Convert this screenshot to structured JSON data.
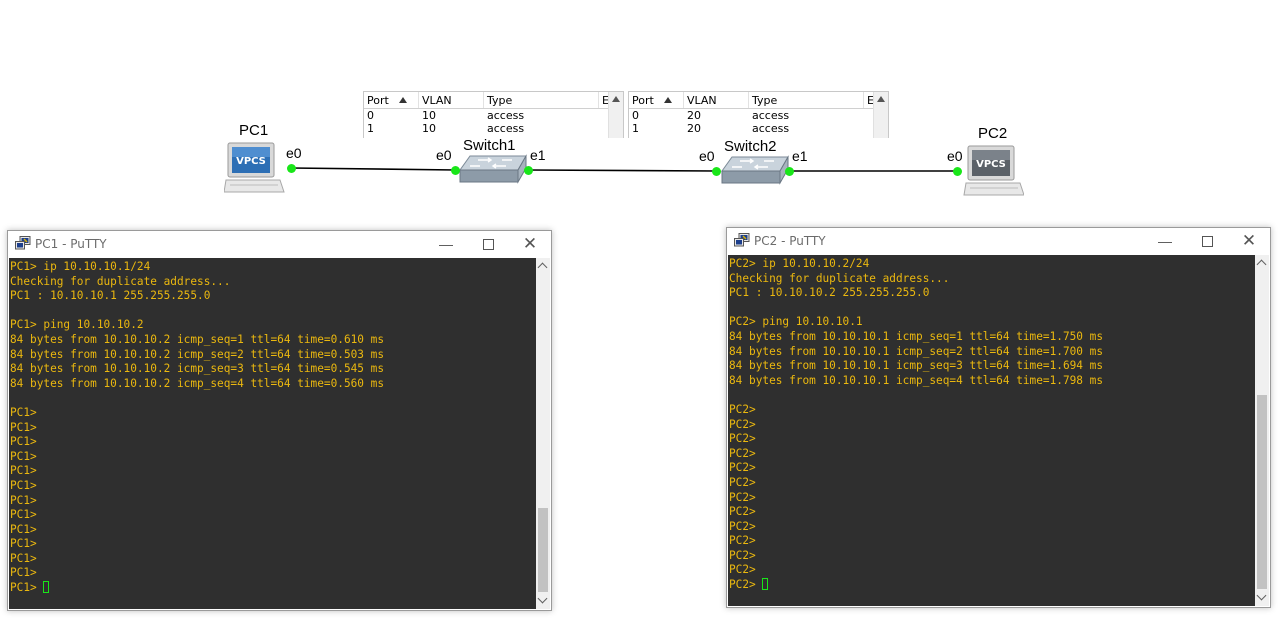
{
  "topology": {
    "nodes": {
      "pc1": {
        "label": "PC1",
        "icon_text": "VPCS"
      },
      "pc2": {
        "label": "PC2",
        "icon_text": "VPCS"
      },
      "switch1": {
        "label": "Switch1"
      },
      "switch2": {
        "label": "Switch2"
      }
    },
    "ports": {
      "pc1_e0": "e0",
      "sw1_e0": "e0",
      "sw1_e1": "e1",
      "sw2_e0": "e0",
      "sw2_e1": "e1",
      "pc2_e0": "e0"
    },
    "link_color": "#000000",
    "port_status_color": "#19e619"
  },
  "switch1_table": {
    "columns": [
      "Port",
      "VLAN",
      "Type",
      "Et"
    ],
    "rows": [
      {
        "port": "0",
        "vlan": "10",
        "type": "access"
      },
      {
        "port": "1",
        "vlan": "10",
        "type": "access"
      }
    ]
  },
  "switch2_table": {
    "columns": [
      "Port",
      "VLAN",
      "Type",
      "Et"
    ],
    "rows": [
      {
        "port": "0",
        "vlan": "20",
        "type": "access"
      },
      {
        "port": "1",
        "vlan": "20",
        "type": "access"
      }
    ]
  },
  "putty1": {
    "title": "PC1 - PuTTY",
    "terminal_lines": [
      "PC1> ip 10.10.10.1/24",
      "Checking for duplicate address...",
      "PC1 : 10.10.10.1 255.255.255.0",
      "",
      "PC1> ping 10.10.10.2",
      "84 bytes from 10.10.10.2 icmp_seq=1 ttl=64 time=0.610 ms",
      "84 bytes from 10.10.10.2 icmp_seq=2 ttl=64 time=0.503 ms",
      "84 bytes from 10.10.10.2 icmp_seq=3 ttl=64 time=0.545 ms",
      "84 bytes from 10.10.10.2 icmp_seq=4 ttl=64 time=0.560 ms",
      "",
      "PC1>",
      "PC1>",
      "PC1>",
      "PC1>",
      "PC1>",
      "PC1>",
      "PC1>",
      "PC1>",
      "PC1>",
      "PC1>",
      "PC1>",
      "PC1>"
    ],
    "prompt": "PC1> ",
    "text_color": "#ebb80f",
    "background": "#2f2f2f"
  },
  "putty2": {
    "title": "PC2 - PuTTY",
    "terminal_lines": [
      "PC2> ip 10.10.10.2/24",
      "Checking for duplicate address...",
      "PC1 : 10.10.10.2 255.255.255.0",
      "",
      "PC2> ping 10.10.10.1",
      "84 bytes from 10.10.10.1 icmp_seq=1 ttl=64 time=1.750 ms",
      "84 bytes from 10.10.10.1 icmp_seq=2 ttl=64 time=1.700 ms",
      "84 bytes from 10.10.10.1 icmp_seq=3 ttl=64 time=1.694 ms",
      "84 bytes from 10.10.10.1 icmp_seq=4 ttl=64 time=1.798 ms",
      "",
      "PC2>",
      "PC2>",
      "PC2>",
      "PC2>",
      "PC2>",
      "PC2>",
      "PC2>",
      "PC2>",
      "PC2>",
      "PC2>",
      "PC2>",
      "PC2>"
    ],
    "prompt": "PC2> ",
    "text_color": "#ebb80f",
    "background": "#2f2f2f"
  },
  "window_controls": {
    "minimize_icon": "minimize-icon",
    "maximize_icon": "maximize-icon",
    "close_icon": "close-icon"
  }
}
